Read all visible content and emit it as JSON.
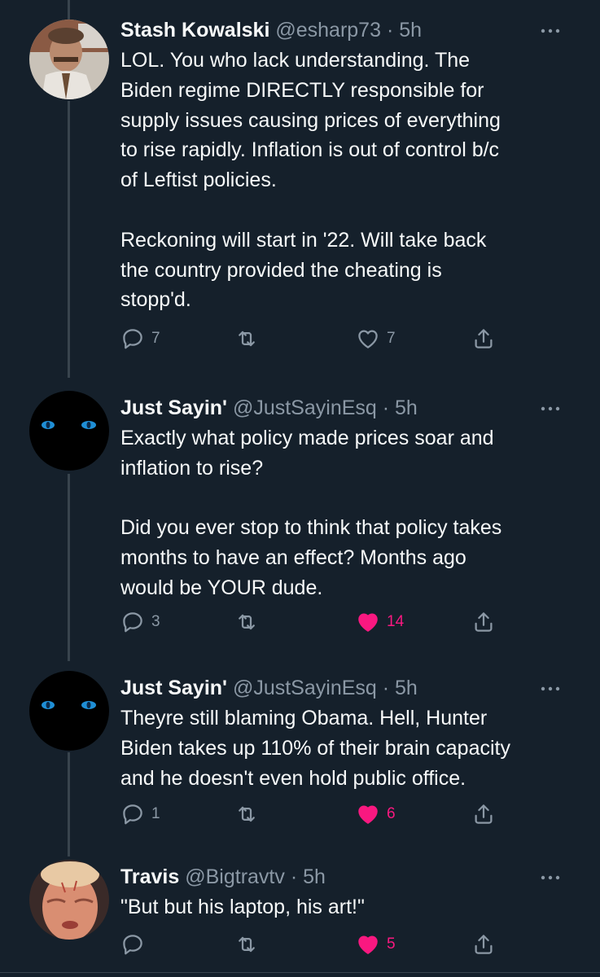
{
  "colors": {
    "background": "#15202b",
    "text": "#f7f9f9",
    "muted": "#8b98a5",
    "like_active": "#f91880",
    "thread_line": "#38444d"
  },
  "icons": {
    "reply": "reply-icon",
    "retweet": "retweet-icon",
    "like": "heart-icon",
    "share": "share-icon",
    "more": "more-icon"
  },
  "tweets": [
    {
      "name": "Stash Kowalski",
      "handle": "@esharp73",
      "dot": "·",
      "time": "5h",
      "text": "LOL. You who lack understanding. The\nBiden regime DIRECTLY responsible for\nsupply issues causing prices of everything\nto rise rapidly. Inflation is out of control b/c\nof Leftist policies.\n\nReckoning will start in '22. Will take back\nthe country provided the cheating is\nstopp'd.",
      "replies": "7",
      "retweets": "",
      "likes": "7",
      "liked": false
    },
    {
      "name": "Just Sayin'",
      "handle": "@JustSayinEsq",
      "dot": "·",
      "time": "5h",
      "text": "Exactly what policy made prices soar and\ninflation to rise?\n\nDid you ever stop to think that policy takes\nmonths to have an effect? Months ago\nwould be YOUR dude.",
      "replies": "3",
      "retweets": "",
      "likes": "14",
      "liked": true
    },
    {
      "name": "Just Sayin'",
      "handle": "@JustSayinEsq",
      "dot": "·",
      "time": "5h",
      "text": "Theyre still blaming Obama. Hell, Hunter\nBiden takes up 110% of their brain capacity\nand he doesn't even hold public office.",
      "replies": "1",
      "retweets": "",
      "likes": "6",
      "liked": true
    },
    {
      "name": "Travis",
      "handle": "@Bigtravtv",
      "dot": "·",
      "time": "5h",
      "text": "\"But but his laptop, his art!\"",
      "replies": "",
      "retweets": "",
      "likes": "5",
      "liked": true
    }
  ]
}
